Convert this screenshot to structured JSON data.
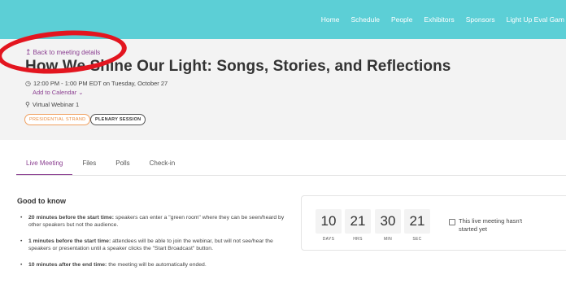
{
  "nav": [
    "Home",
    "Schedule",
    "People",
    "Exhibitors",
    "Sponsors",
    "Light Up Eval Gam"
  ],
  "header": {
    "back_label": "Back to meeting details",
    "title": "How We Shine Our Light: Songs, Stories, and Reflections",
    "time": "12:00 PM - 1:00 PM EDT on Tuesday, October 27",
    "add_to_calendar": "Add to Calendar",
    "location": "Virtual Webinar 1",
    "badges": [
      "PRESIDENTIAL STRAND",
      "PLENARY SESSION"
    ]
  },
  "tabs": [
    "Live Meeting",
    "Files",
    "Polls",
    "Check-in"
  ],
  "good_to_know": {
    "heading": "Good to know",
    "items": [
      {
        "bold": "20 minutes before the start time:",
        "text": " speakers can enter a \"green room\" where they can be seen/heard by other speakers but not the audience."
      },
      {
        "bold": "1 minutes before the start time:",
        "text": " attendees will be able to join the webinar, but will not see/hear the speakers or presentation until a speaker clicks the \"Start Broadcast\" button."
      },
      {
        "bold": "10 minutes after the end time:",
        "text": " the meeting will be automatically ended."
      }
    ]
  },
  "countdown": {
    "days": {
      "value": "10",
      "label": "DAYS"
    },
    "hrs": {
      "value": "21",
      "label": "HRS"
    },
    "min": {
      "value": "30",
      "label": "MIN"
    },
    "sec": {
      "value": "21",
      "label": "SEC"
    },
    "status": "This live meeting hasn't started yet"
  },
  "colors": {
    "nav_bg": "#5ccfd6",
    "accent": "#8b3f91",
    "annotation": "#e3151f"
  }
}
